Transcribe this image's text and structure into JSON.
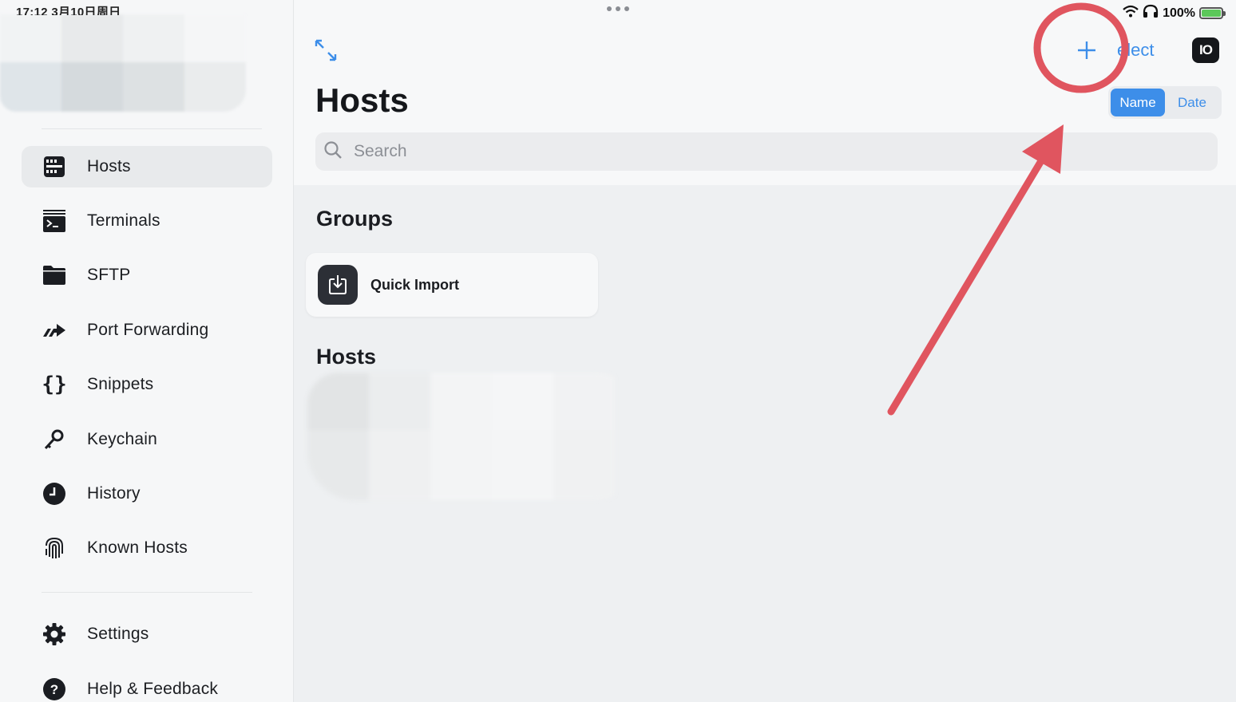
{
  "status_bar": {
    "time_date": "17:12 3月10日周日",
    "battery_percent": "100%",
    "battery_color": "#5cc85a",
    "icons": [
      "wifi-icon",
      "headphones-icon",
      "battery-icon"
    ]
  },
  "window": {
    "multitask_icon": "ellipsis-icon"
  },
  "sidebar": {
    "items": [
      {
        "label": "Hosts",
        "icon": "hosts-icon",
        "active": true
      },
      {
        "label": "Terminals",
        "icon": "terminal-icon"
      },
      {
        "label": "SFTP",
        "icon": "folder-icon"
      },
      {
        "label": "Port Forwarding",
        "icon": "port-forward-icon"
      },
      {
        "label": "Snippets",
        "icon": "braces-icon"
      },
      {
        "label": "Keychain",
        "icon": "key-icon"
      },
      {
        "label": "History",
        "icon": "clock-icon"
      },
      {
        "label": "Known Hosts",
        "icon": "fingerprint-icon"
      }
    ],
    "footer_items": [
      {
        "label": "Settings",
        "icon": "gear-icon"
      },
      {
        "label": "Help & Feedback",
        "icon": "help-icon"
      }
    ]
  },
  "header": {
    "title": "Hosts",
    "add_icon": "plus-icon",
    "select_label": "elect",
    "logo_text": "IO",
    "sort_options": [
      "Name",
      "Date"
    ],
    "sort_selected": "Name"
  },
  "search": {
    "placeholder": "Search",
    "value": ""
  },
  "sections": {
    "groups_title": "Groups",
    "hosts_title": "Hosts"
  },
  "groups": [
    {
      "label": "Quick Import",
      "icon": "import-icon"
    }
  ],
  "colors": {
    "accent": "#3d8ee9",
    "annotation_red": "#e0555f",
    "sidebar_bg": "#f6f7f8",
    "main_bg": "#eef0f2"
  }
}
